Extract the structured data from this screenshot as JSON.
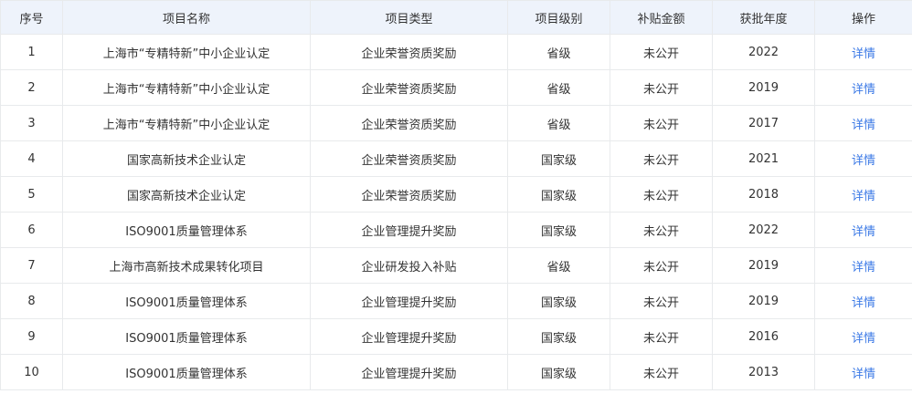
{
  "table": {
    "columns": [
      "序号",
      "项目名称",
      "项目类型",
      "项目级别",
      "补贴金额",
      "获批年度",
      "操作"
    ],
    "rows": [
      {
        "index": "1",
        "name": "上海市“专精特新”中小企业认定",
        "type": "企业荣誉资质奖励",
        "level": "省级",
        "amount": "未公开",
        "year": "2022",
        "action": "详情"
      },
      {
        "index": "2",
        "name": "上海市“专精特新”中小企业认定",
        "type": "企业荣誉资质奖励",
        "level": "省级",
        "amount": "未公开",
        "year": "2019",
        "action": "详情"
      },
      {
        "index": "3",
        "name": "上海市“专精特新”中小企业认定",
        "type": "企业荣誉资质奖励",
        "level": "省级",
        "amount": "未公开",
        "year": "2017",
        "action": "详情"
      },
      {
        "index": "4",
        "name": "国家高新技术企业认定",
        "type": "企业荣誉资质奖励",
        "level": "国家级",
        "amount": "未公开",
        "year": "2021",
        "action": "详情"
      },
      {
        "index": "5",
        "name": "国家高新技术企业认定",
        "type": "企业荣誉资质奖励",
        "level": "国家级",
        "amount": "未公开",
        "year": "2018",
        "action": "详情"
      },
      {
        "index": "6",
        "name": "ISO9001质量管理体系",
        "type": "企业管理提升奖励",
        "level": "国家级",
        "amount": "未公开",
        "year": "2022",
        "action": "详情"
      },
      {
        "index": "7",
        "name": "上海市高新技术成果转化项目",
        "type": "企业研发投入补贴",
        "level": "省级",
        "amount": "未公开",
        "year": "2019",
        "action": "详情"
      },
      {
        "index": "8",
        "name": "ISO9001质量管理体系",
        "type": "企业管理提升奖励",
        "level": "国家级",
        "amount": "未公开",
        "year": "2019",
        "action": "详情"
      },
      {
        "index": "9",
        "name": "ISO9001质量管理体系",
        "type": "企业管理提升奖励",
        "level": "国家级",
        "amount": "未公开",
        "year": "2016",
        "action": "详情"
      },
      {
        "index": "10",
        "name": "ISO9001质量管理体系",
        "type": "企业管理提升奖励",
        "level": "国家级",
        "amount": "未公开",
        "year": "2013",
        "action": "详情"
      }
    ]
  },
  "colors": {
    "header_bg": "#eef3fb",
    "border": "#e8eaec",
    "link": "#3a78e6",
    "text": "#333333"
  }
}
